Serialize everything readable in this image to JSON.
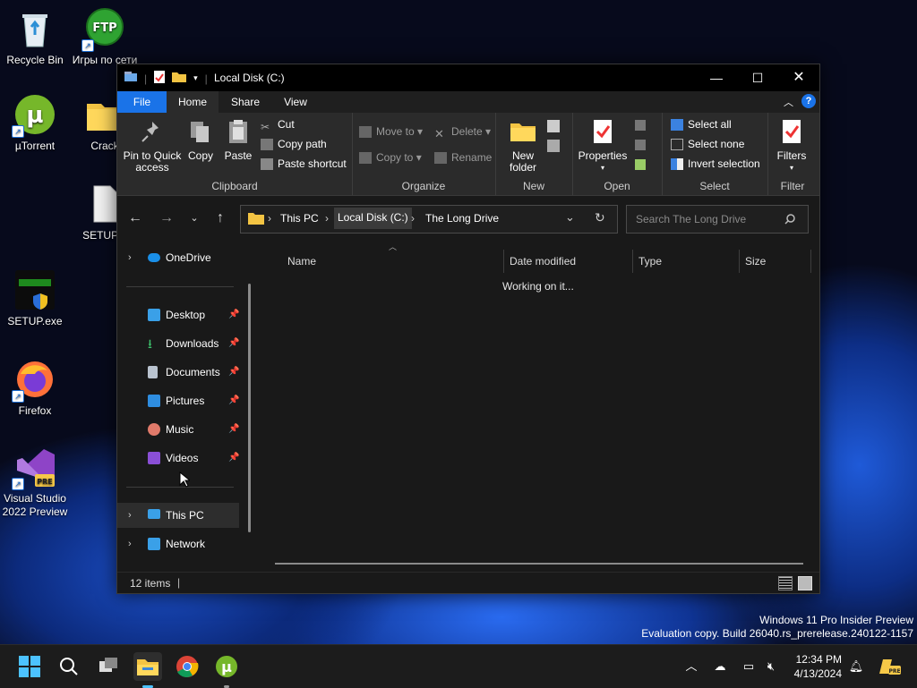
{
  "desktop": {
    "icons": [
      {
        "label": "Recycle Bin"
      },
      {
        "label": "Игры по сети"
      },
      {
        "label": "µTorrent"
      },
      {
        "label": "Crack"
      },
      {
        "label": "SETUP.E"
      },
      {
        "label": "SETUP.exe"
      },
      {
        "label": "Firefox"
      },
      {
        "label": "Visual Studio 2022 Preview"
      }
    ]
  },
  "window": {
    "title": "Local Disk (C:)",
    "tabs": [
      "File",
      "Home",
      "Share",
      "View"
    ],
    "ribbon": {
      "clipboard": {
        "name": "Clipboard",
        "pin": "Pin to Quick access",
        "copy": "Copy",
        "paste": "Paste",
        "cut": "Cut",
        "copy_path": "Copy path",
        "paste_shortcut": "Paste shortcut"
      },
      "organize": {
        "name": "Organize",
        "move_to": "Move to",
        "copy_to": "Copy to",
        "delete": "Delete",
        "rename": "Rename"
      },
      "new": {
        "name": "New",
        "new_folder": "New folder"
      },
      "open": {
        "name": "Open",
        "properties": "Properties"
      },
      "select": {
        "name": "Select",
        "select_all": "Select all",
        "select_none": "Select none",
        "invert": "Invert selection"
      },
      "filter": {
        "name": "Filter",
        "filters": "Filters"
      }
    },
    "address": {
      "crumbs": [
        "This PC",
        "Local Disk (C:)",
        "The Long Drive"
      ],
      "search_placeholder": "Search The Long Drive"
    },
    "nav": {
      "onedrive": "OneDrive",
      "quick": [
        "Desktop",
        "Downloads",
        "Documents",
        "Pictures",
        "Music",
        "Videos"
      ],
      "this_pc": "This PC",
      "network": "Network"
    },
    "columns": [
      "Name",
      "Date modified",
      "Type",
      "Size"
    ],
    "status_message": "Working on it...",
    "status_count": "12 items"
  },
  "watermark": {
    "line1": "Windows 11 Pro Insider Preview",
    "line2": "Evaluation copy. Build 26040.rs_prerelease.240122-1157"
  },
  "taskbar": {
    "time": "12:34 PM",
    "date": "4/13/2024"
  },
  "colors": {
    "accent": "#1a73e8",
    "window_bg": "#191919",
    "ribbon_bg": "#2b2b2b"
  }
}
